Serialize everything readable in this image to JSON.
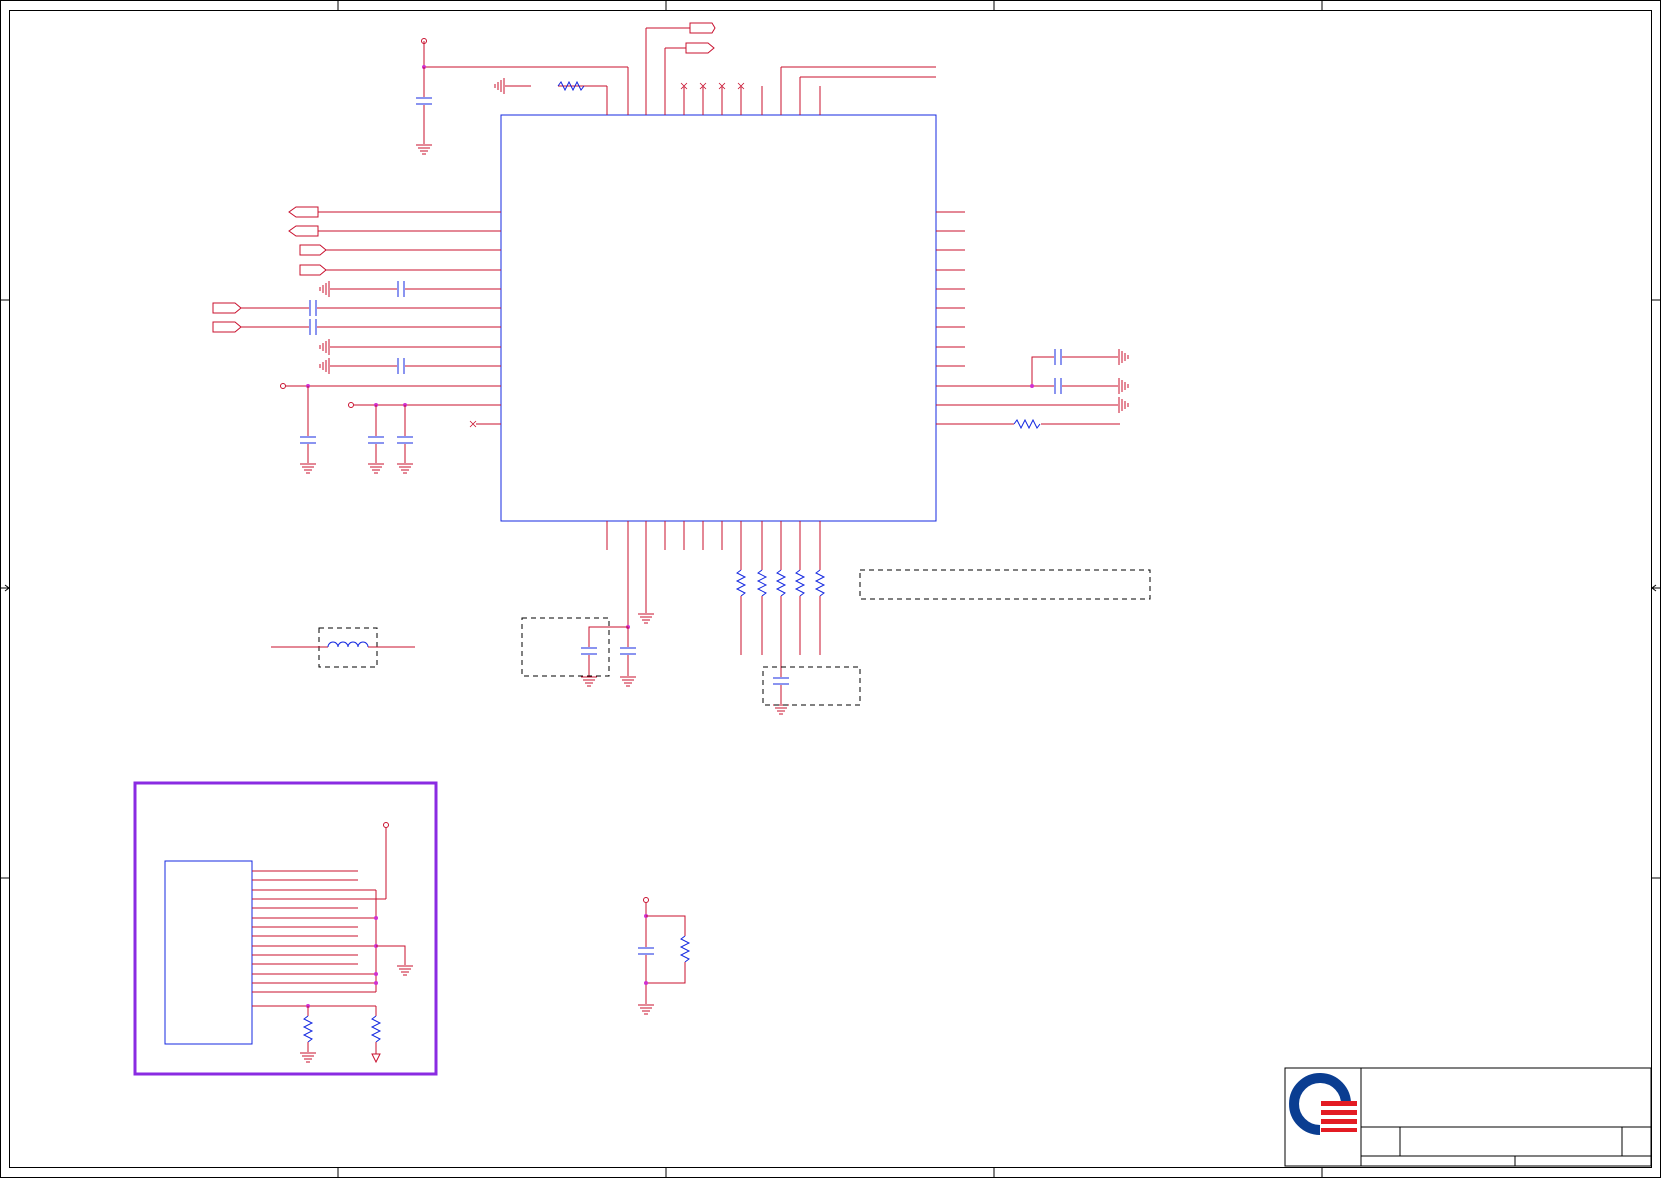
{
  "sheet": {
    "frame_color": "#000000",
    "wire_color": "#c8102e",
    "component_color": "#1428e0",
    "junction_color": "#d030d0",
    "highlight_box_color": "#8a2be2"
  },
  "title_block": {
    "logo": "logo-icon",
    "logo_colors": [
      "#0a3d91",
      "#e31b23"
    ]
  }
}
